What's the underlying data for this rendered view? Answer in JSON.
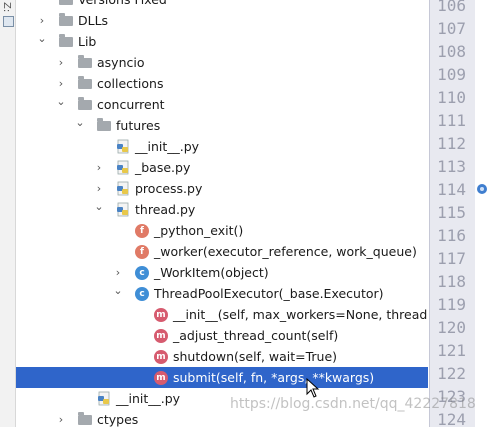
{
  "left_strip": {
    "vertical_label": "Z:"
  },
  "tree": [
    {
      "id": "partial",
      "depth": 0,
      "expander": "none",
      "icon": "folder",
      "label": "Versions Fixed"
    },
    {
      "id": "dlls",
      "depth": 0,
      "expander": "collapsed",
      "icon": "folder",
      "label": "DLLs"
    },
    {
      "id": "lib",
      "depth": 0,
      "expander": "expanded",
      "icon": "folder",
      "label": "Lib"
    },
    {
      "id": "asyncio",
      "depth": 1,
      "expander": "collapsed",
      "icon": "folder",
      "label": "asyncio"
    },
    {
      "id": "collections",
      "depth": 1,
      "expander": "collapsed",
      "icon": "folder",
      "label": "collections"
    },
    {
      "id": "concurrent",
      "depth": 1,
      "expander": "expanded",
      "icon": "folder",
      "label": "concurrent"
    },
    {
      "id": "futures",
      "depth": 2,
      "expander": "expanded",
      "icon": "folder",
      "label": "futures"
    },
    {
      "id": "init-futures",
      "depth": 3,
      "expander": "none",
      "icon": "python-file",
      "label": "__init__.py"
    },
    {
      "id": "base",
      "depth": 3,
      "expander": "collapsed",
      "icon": "python-file",
      "label": "_base.py"
    },
    {
      "id": "process",
      "depth": 3,
      "expander": "collapsed",
      "icon": "python-file",
      "label": "process.py"
    },
    {
      "id": "thread",
      "depth": 3,
      "expander": "expanded",
      "icon": "python-file",
      "label": "thread.py"
    },
    {
      "id": "python-exit",
      "depth": 4,
      "expander": "none",
      "icon": "function",
      "badge": "f",
      "label": "_python_exit()"
    },
    {
      "id": "worker",
      "depth": 4,
      "expander": "none",
      "icon": "function",
      "badge": "f",
      "label": "_worker(executor_reference, work_queue)"
    },
    {
      "id": "workitem",
      "depth": 4,
      "expander": "collapsed",
      "icon": "class",
      "badge": "c",
      "label": "_WorkItem(object)"
    },
    {
      "id": "tpe",
      "depth": 4,
      "expander": "expanded",
      "icon": "class",
      "badge": "c",
      "label": "ThreadPoolExecutor(_base.Executor)"
    },
    {
      "id": "m-init",
      "depth": 5,
      "expander": "none",
      "icon": "method",
      "badge": "m",
      "label": "__init__(self, max_workers=None, thread"
    },
    {
      "id": "m-adjust",
      "depth": 5,
      "expander": "none",
      "icon": "method",
      "badge": "m",
      "label": "_adjust_thread_count(self)"
    },
    {
      "id": "m-shutdown",
      "depth": 5,
      "expander": "none",
      "icon": "method",
      "badge": "m",
      "label": "shutdown(self, wait=True)"
    },
    {
      "id": "m-submit",
      "depth": 5,
      "expander": "none",
      "icon": "method",
      "badge": "m",
      "label": "submit(self, fn, *args, **kwargs)",
      "selected": true
    },
    {
      "id": "init-concurrent",
      "depth": 2,
      "expander": "none",
      "icon": "python-file",
      "label": "__init__.py"
    },
    {
      "id": "ctypes",
      "depth": 1,
      "expander": "collapsed",
      "icon": "folder",
      "label": "ctypes"
    }
  ],
  "gutter": {
    "line_numbers": [
      "106",
      "107",
      "108",
      "109",
      "110",
      "111",
      "112",
      "113",
      "114",
      "115",
      "116",
      "117",
      "118",
      "119",
      "120",
      "121",
      "122",
      "123",
      "124"
    ],
    "highlighted_line": "114"
  },
  "watermark": "https://blog.csdn.net/qq_42227818",
  "colors": {
    "selection": "#2f65ca",
    "gutter_bg": "#e8e9f0",
    "gutter_text": "#9c9fae"
  }
}
